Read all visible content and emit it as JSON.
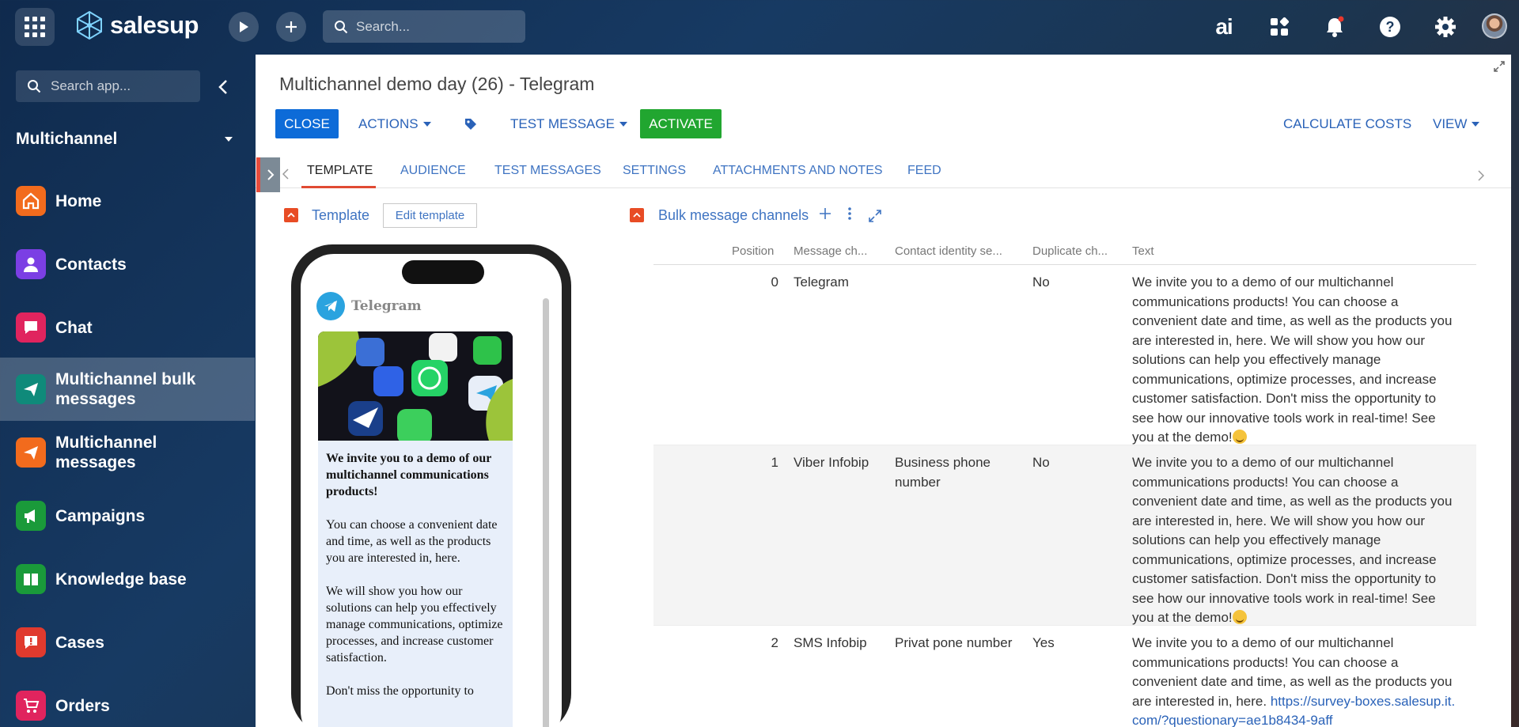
{
  "topbar": {
    "logo_text": "salesup",
    "search_placeholder": "Search...",
    "ai_label": "ai"
  },
  "sidebar": {
    "search_placeholder": "Search app...",
    "section_label": "Multichannel",
    "items": [
      {
        "label": "Home",
        "icon": "home-icon",
        "color": "#f26b1d"
      },
      {
        "label": "Contacts",
        "icon": "person-icon",
        "color": "#7b3fe4"
      },
      {
        "label": "Chat",
        "icon": "chat-icon",
        "color": "#e0245e"
      },
      {
        "label": "Multichannel bulk messages",
        "icon": "send-icon",
        "color": "#0f8a7a"
      },
      {
        "label": "Multichannel messages",
        "icon": "send-icon",
        "color": "#f26b1d"
      },
      {
        "label": "Campaigns",
        "icon": "megaphone-icon",
        "color": "#1a9a3a"
      },
      {
        "label": "Knowledge base",
        "icon": "book-icon",
        "color": "#1a9a3a"
      },
      {
        "label": "Cases",
        "icon": "alert-icon",
        "color": "#e03a2e"
      },
      {
        "label": "Orders",
        "icon": "cart-icon",
        "color": "#e0245e"
      }
    ]
  },
  "page": {
    "title": "Multichannel demo day (26) - Telegram",
    "actions": {
      "close": "CLOSE",
      "actions": "ACTIONS",
      "test_message": "TEST MESSAGE",
      "activate": "ACTIVATE",
      "calculate_costs": "CALCULATE COSTS",
      "view": "VIEW"
    },
    "tabs": [
      "TEMPLATE",
      "AUDIENCE",
      "TEST MESSAGES",
      "SETTINGS",
      "ATTACHMENTS AND NOTES",
      "FEED"
    ]
  },
  "template": {
    "title": "Template",
    "edit_button": "Edit template",
    "preview": {
      "channel_name": "Telegram",
      "heading": "We invite you to a demo of our multichannel communications products!",
      "para1": "You can choose a convenient date and time, as well as the products you are interested in, here.",
      "para2": "We will show you how our solutions can help you effectively manage communications, optimize processes, and increase customer satisfaction.",
      "para3": "Don't miss the opportunity to"
    }
  },
  "channels": {
    "title": "Bulk message channels",
    "columns": [
      "Position",
      "Message ch...",
      "Contact identity se...",
      "Duplicate ch...",
      "Text"
    ],
    "rows": [
      {
        "position": "0",
        "channel": "Telegram",
        "contact_identity": "",
        "duplicate": "No",
        "text": "We invite you to a demo of our multichannel communications products! You can choose a convenient date and time, as well as the products you are interested in, here. We will show you how our solutions can help you effectively manage communications, optimize processes, and increase customer satisfaction. Don't miss the opportunity to see how our innovative tools work in real-time! See you at the demo!"
      },
      {
        "position": "1",
        "channel": "Viber Infobip",
        "contact_identity": "Business phone number",
        "duplicate": "No",
        "text": "We invite you to a demo of our multichannel communications products! You can choose a convenient date and time, as well as the products you are interested in, here. We will show you how our solutions can help you effectively manage communications, optimize processes, and increase customer satisfaction. Don't miss the opportunity to see how our innovative tools work in real-time! See you at the demo!"
      },
      {
        "position": "2",
        "channel": "SMS Infobip",
        "contact_identity": "Privat pone number",
        "duplicate": "Yes",
        "text": "We invite you to a demo of our multichannel communications products! You can choose a convenient date and time, as well as the products you are interested in, here.",
        "link": "https://survey-boxes.salesup.it.com/?questionary=ae1b8434-9aff"
      }
    ]
  }
}
